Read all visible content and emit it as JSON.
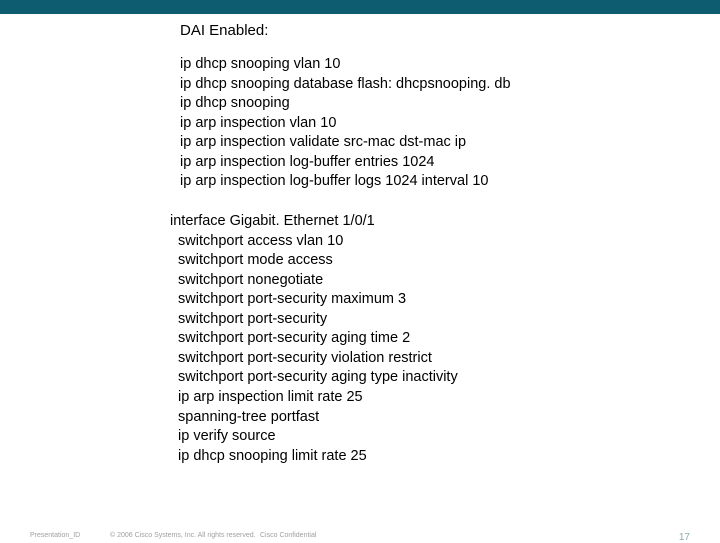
{
  "title": "DAI Enabled:",
  "global_config": "ip dhcp snooping vlan 10\nip dhcp snooping database flash: dhcpsnooping. db\nip dhcp snooping\nip arp inspection vlan 10\nip arp inspection validate src-mac dst-mac ip\nip arp inspection log-buffer entries 1024\nip arp inspection log-buffer logs 1024 interval 10",
  "interface_config": "interface Gigabit. Ethernet 1/0/1\n  switchport access vlan 10\n  switchport mode access\n  switchport nonegotiate\n  switchport port-security maximum 3\n  switchport port-security\n  switchport port-security aging time 2\n  switchport port-security violation restrict\n  switchport port-security aging type inactivity\n  ip arp inspection limit rate 25\n  spanning-tree portfast\n  ip verify source\n  ip dhcp snooping limit rate 25",
  "footer": {
    "presentation_id": "Presentation_ID",
    "copyright": "© 2006 Cisco Systems, Inc. All rights reserved.",
    "confidential": "Cisco Confidential",
    "page": "17"
  }
}
